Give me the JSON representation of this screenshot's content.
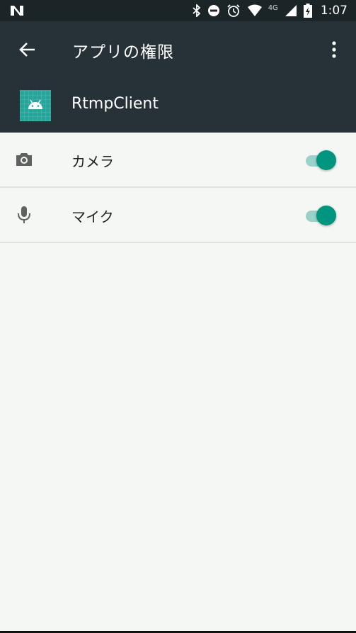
{
  "status_bar": {
    "network": "4G",
    "time": "1:07"
  },
  "app_bar": {
    "title": "アプリの権限"
  },
  "app": {
    "name": "RtmpClient"
  },
  "permissions": [
    {
      "label": "カメラ",
      "icon": "camera-icon",
      "enabled": true
    },
    {
      "label": "マイク",
      "icon": "microphone-icon",
      "enabled": true
    }
  ],
  "colors": {
    "status_bar": "#1b2427",
    "app_bar": "#263238",
    "accent": "#00957e",
    "background": "#f5f7f5"
  }
}
